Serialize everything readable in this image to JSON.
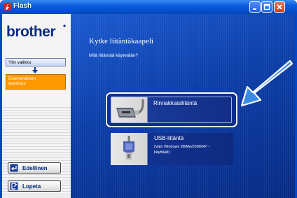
{
  "window": {
    "title": "Flash",
    "colors": {
      "titlebar": "#0552d0",
      "accent_orange": "#ff9900",
      "arrow_blue": "#3b8be6"
    }
  },
  "sidebar": {
    "logo": "brother",
    "nav_top_label": "Ylin valikko",
    "nav_current_label_line1": "Ensimmäinen",
    "nav_current_label_line2": "asennus",
    "back_button_label": "Edellinen",
    "exit_button_label": "Lopeta"
  },
  "main": {
    "heading": "Kytke liitäntäkaapeli",
    "subheading": "Mitä liitäntää käytetään?",
    "options": [
      {
        "label": "Rinnakkaisliitäntä",
        "icon": "parallel-cable-icon",
        "selected": true
      },
      {
        "label": "USB-liitäntä",
        "sublabel_line1": "(Vain Windows 98/Me/2000/XP -",
        "sublabel_line2": "käyttäjät)",
        "icon": "usb-cable-icon",
        "selected": false
      }
    ]
  }
}
